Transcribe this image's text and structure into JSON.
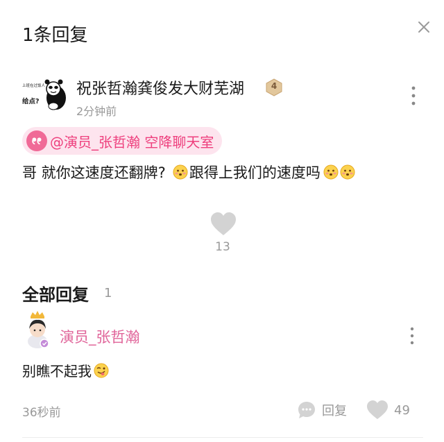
{
  "header": {
    "title": "1条回复",
    "close_icon": "close-icon"
  },
  "comment": {
    "avatar": {
      "icon": "panda-meme-avatar",
      "caption_top": "上班在过饭人",
      "caption_side": "给点?"
    },
    "user_name": "祝张哲瀚龚俊发大财芜湖",
    "level": "4",
    "time": "2分钟前",
    "mention": {
      "icon": "quote-icon",
      "label": "@演员_张哲瀚 空降聊天室"
    },
    "text_part1": "哥 就你这速度还翻牌?",
    "text_part2": "跟得上我们的速度吗",
    "like_count": "13"
  },
  "replies_section": {
    "title": "全部回复",
    "count": "1"
  },
  "reply": {
    "avatar": {
      "icon": "actor-avatar",
      "crown": "crown-icon"
    },
    "user_name": "演员_张哲瀚",
    "text": "别瞧不起我",
    "time": "36秒前",
    "reply_label": "回复",
    "like_count": "49"
  },
  "colors": {
    "accent_pink": "#ee3f7d",
    "chip_bg": "#fde4ee",
    "gray_text": "#999999",
    "badge_gold": "#d9b98c"
  }
}
